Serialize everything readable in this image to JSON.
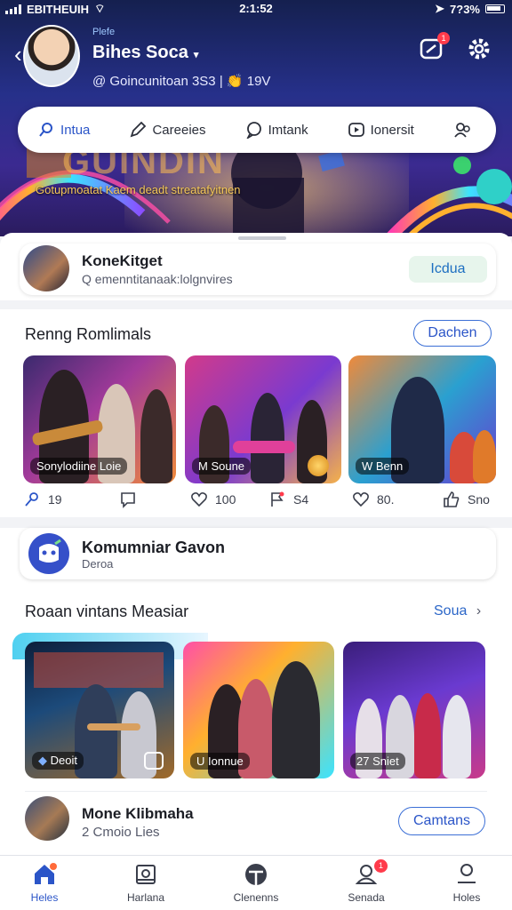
{
  "status_bar": {
    "carrier": "EBITHEUIH",
    "time": "2:1:52",
    "battery": "7?3%"
  },
  "profile": {
    "small_label": "Plefe",
    "name": "Bihes Soca",
    "meta": "@ Goincunitoan 3S3 | 👏 19V",
    "notification_count": "1"
  },
  "hero_tabs": [
    {
      "label": "Intua",
      "icon": "search-icon"
    },
    {
      "label": "Careeies",
      "icon": "pen-icon"
    },
    {
      "label": "Imtank",
      "icon": "chat-icon"
    },
    {
      "label": "Ionersit",
      "icon": "play-icon"
    },
    {
      "label": "",
      "icon": "people-icon"
    }
  ],
  "hero_banner": {
    "big_text": "GUINDIN",
    "caption": "Gotupmoatat Kaem deadt streatafyitnen"
  },
  "mini_card": {
    "title": "KoneKitget",
    "subtitle": "Q emenntitanaak:lolgnvires",
    "button": "Icdua"
  },
  "section1": {
    "title": "Renng Romlimals",
    "button": "Dachen",
    "tiles": [
      {
        "tag": "Sonylodiine Loie"
      },
      {
        "tag": "M Soune"
      },
      {
        "tag": "W Benn"
      }
    ],
    "stats": [
      {
        "icon": "pin-icon",
        "value": "19"
      },
      {
        "icon": "comment-icon",
        "value": ""
      },
      {
        "icon": "heart-icon",
        "value": "100"
      },
      {
        "icon": "flag-icon",
        "value": "S4"
      },
      {
        "icon": "heart-icon",
        "value": "80."
      },
      {
        "icon": "thumbs-up-icon",
        "value": "Sno"
      }
    ]
  },
  "community": {
    "title": "Komumniar Gavon",
    "subtitle": "Deroa"
  },
  "section2": {
    "title": "Roaan vintans Measiar",
    "link": "Soua",
    "tiles": [
      {
        "tag": "Deoit"
      },
      {
        "tag": "U Ionnue"
      },
      {
        "tag": "27 Sniet"
      }
    ]
  },
  "bottom_card": {
    "title": "Mone Klibmaha",
    "subtitle": "2 Cmoio Lies",
    "button": "Camtans"
  },
  "nav": [
    {
      "label": "Heles",
      "icon": "home-icon"
    },
    {
      "label": "Harlana",
      "icon": "photo-icon"
    },
    {
      "label": "Clenenns",
      "icon": "globe-icon"
    },
    {
      "label": "Senada",
      "icon": "bell-icon",
      "badge": "1"
    },
    {
      "label": "Holes",
      "icon": "profile-icon"
    }
  ]
}
